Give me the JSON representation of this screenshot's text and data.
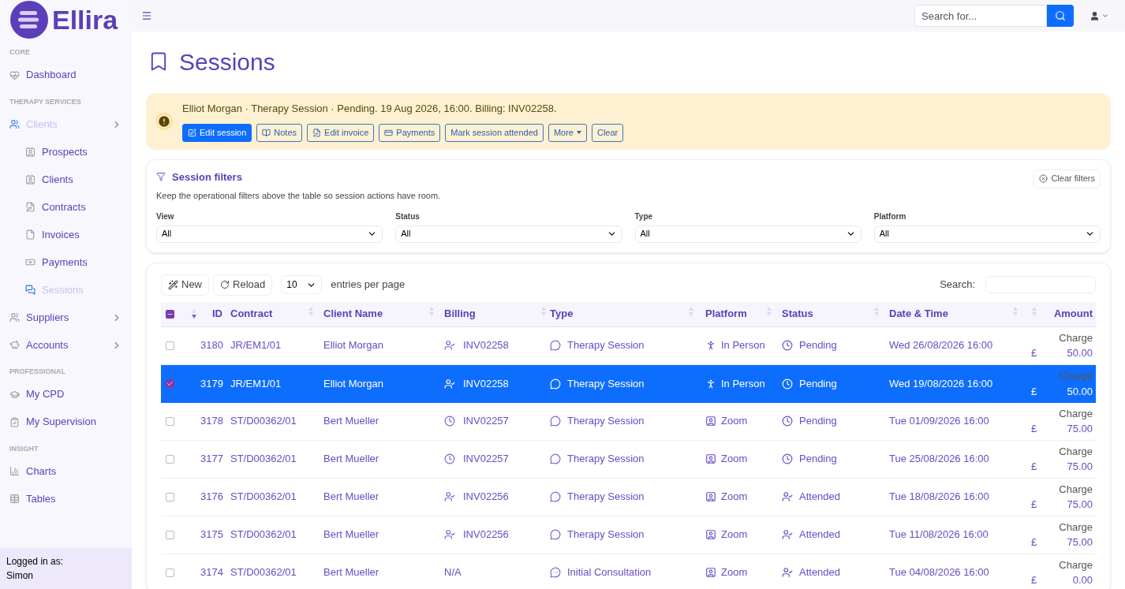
{
  "brand": {
    "name": "Ellira"
  },
  "topbar": {
    "search": {
      "placeholder": "Search for..."
    }
  },
  "sidebar": {
    "sections": [
      {
        "heading": "CORE",
        "items": [
          {
            "label": "Dashboard",
            "selected": false,
            "expandable": false
          }
        ]
      },
      {
        "heading": "THERAPY SERVICES",
        "items": [
          {
            "label": "Clients",
            "selected": true,
            "expandable": true,
            "children": [
              {
                "label": "Prospects",
                "selected": false
              },
              {
                "label": "Clients",
                "selected": false
              },
              {
                "label": "Contracts",
                "selected": false
              },
              {
                "label": "Invoices",
                "selected": false
              },
              {
                "label": "Payments",
                "selected": false
              },
              {
                "label": "Sessions",
                "selected": true
              }
            ]
          },
          {
            "label": "Suppliers",
            "selected": false,
            "expandable": true
          },
          {
            "label": "Accounts",
            "selected": false,
            "expandable": true
          }
        ]
      },
      {
        "heading": "PROFESSIONAL",
        "items": [
          {
            "label": "My CPD",
            "selected": false,
            "expandable": false
          },
          {
            "label": "My Supervision",
            "selected": false,
            "expandable": false
          }
        ]
      },
      {
        "heading": "INSIGHT",
        "items": [
          {
            "label": "Charts",
            "selected": false,
            "expandable": false
          },
          {
            "label": "Tables",
            "selected": false,
            "expandable": false
          }
        ]
      }
    ],
    "footer": {
      "label": "Logged in as:",
      "user": "Simon"
    }
  },
  "page": {
    "title": "Sessions"
  },
  "alert": {
    "message": "Elliot Morgan · Therapy Session · Pending. 19 Aug 2026, 16:00. Billing: INV02258.",
    "buttons": [
      {
        "label": "Edit session",
        "primary": true,
        "dropdown": false
      },
      {
        "label": "Notes",
        "primary": false,
        "dropdown": false
      },
      {
        "label": "Edit invoice",
        "primary": false,
        "dropdown": false
      },
      {
        "label": "Payments",
        "primary": false,
        "dropdown": false
      },
      {
        "label": "Mark session attended",
        "primary": false,
        "dropdown": false
      },
      {
        "label": "More",
        "primary": false,
        "dropdown": true
      },
      {
        "label": "Clear",
        "primary": false,
        "dropdown": false
      }
    ]
  },
  "filters": {
    "title": "Session filters",
    "description": "Keep the operational filters above the table so session actions have room.",
    "clear": "Clear filters",
    "fields": [
      {
        "label": "View",
        "value": "All"
      },
      {
        "label": "Status",
        "value": "All"
      },
      {
        "label": "Type",
        "value": "All"
      },
      {
        "label": "Platform",
        "value": "All"
      }
    ]
  },
  "table": {
    "toolbar": {
      "new": "New",
      "reload": "Reload",
      "page_size": "10",
      "page_size_label": "entries per page",
      "search_label": "Search:"
    },
    "select_all": {
      "indeterminate": true
    },
    "columns": [
      "ID",
      "Contract",
      "Client Name",
      "Billing",
      "Type",
      "Platform",
      "Status",
      "Date & Time",
      "Amount"
    ],
    "rows": [
      {
        "selected": false,
        "id": "3180",
        "contract": "JR/EM1/01",
        "client": "Elliot Morgan",
        "billing": {
          "kind": "attended",
          "text": "INV02258"
        },
        "type": {
          "kind": "session",
          "text": "Therapy Session"
        },
        "platform": {
          "kind": "in_person",
          "text": "In Person"
        },
        "status": {
          "kind": "pending",
          "text": "Pending"
        },
        "datetime": "Wed 26/08/2026 16:00",
        "amount_label": "Charge",
        "currency": "£",
        "amount": "50.00"
      },
      {
        "selected": true,
        "id": "3179",
        "contract": "JR/EM1/01",
        "client": "Elliot Morgan",
        "billing": {
          "kind": "attended",
          "text": "INV02258"
        },
        "type": {
          "kind": "session",
          "text": "Therapy Session"
        },
        "platform": {
          "kind": "in_person",
          "text": "In Person"
        },
        "status": {
          "kind": "pending",
          "text": "Pending"
        },
        "datetime": "Wed 19/08/2026 16:00",
        "amount_label": "Charge",
        "currency": "£",
        "amount": "50.00"
      },
      {
        "selected": false,
        "id": "3178",
        "contract": "ST/D00362/01",
        "client": "Bert Mueller",
        "billing": {
          "kind": "pending",
          "text": "INV02257"
        },
        "type": {
          "kind": "session",
          "text": "Therapy Session"
        },
        "platform": {
          "kind": "zoom",
          "text": "Zoom"
        },
        "status": {
          "kind": "pending",
          "text": "Pending"
        },
        "datetime": "Tue 01/09/2026 16:00",
        "amount_label": "Charge",
        "currency": "£",
        "amount": "75.00"
      },
      {
        "selected": false,
        "id": "3177",
        "contract": "ST/D00362/01",
        "client": "Bert Mueller",
        "billing": {
          "kind": "pending",
          "text": "INV02257"
        },
        "type": {
          "kind": "session",
          "text": "Therapy Session"
        },
        "platform": {
          "kind": "zoom",
          "text": "Zoom"
        },
        "status": {
          "kind": "pending",
          "text": "Pending"
        },
        "datetime": "Tue 25/08/2026 16:00",
        "amount_label": "Charge",
        "currency": "£",
        "amount": "75.00"
      },
      {
        "selected": false,
        "id": "3176",
        "contract": "ST/D00362/01",
        "client": "Bert Mueller",
        "billing": {
          "kind": "attended",
          "text": "INV02256"
        },
        "type": {
          "kind": "session",
          "text": "Therapy Session"
        },
        "platform": {
          "kind": "zoom",
          "text": "Zoom"
        },
        "status": {
          "kind": "attended",
          "text": "Attended"
        },
        "datetime": "Tue 18/08/2026 16:00",
        "amount_label": "Charge",
        "currency": "£",
        "amount": "75.00"
      },
      {
        "selected": false,
        "id": "3175",
        "contract": "ST/D00362/01",
        "client": "Bert Mueller",
        "billing": {
          "kind": "attended",
          "text": "INV02256"
        },
        "type": {
          "kind": "session",
          "text": "Therapy Session"
        },
        "platform": {
          "kind": "zoom",
          "text": "Zoom"
        },
        "status": {
          "kind": "attended",
          "text": "Attended"
        },
        "datetime": "Tue 11/08/2026 16:00",
        "amount_label": "Charge",
        "currency": "£",
        "amount": "75.00"
      },
      {
        "selected": false,
        "id": "3174",
        "contract": "ST/D00362/01",
        "client": "Bert Mueller",
        "billing": {
          "kind": "none",
          "text": "N/A"
        },
        "type": {
          "kind": "consultation",
          "text": "Initial Consultation"
        },
        "platform": {
          "kind": "zoom",
          "text": "Zoom"
        },
        "status": {
          "kind": "attended",
          "text": "Attended"
        },
        "datetime": "Tue 04/08/2026 16:00",
        "amount_label": "Charge",
        "currency": "£",
        "amount": "0.00"
      }
    ]
  }
}
